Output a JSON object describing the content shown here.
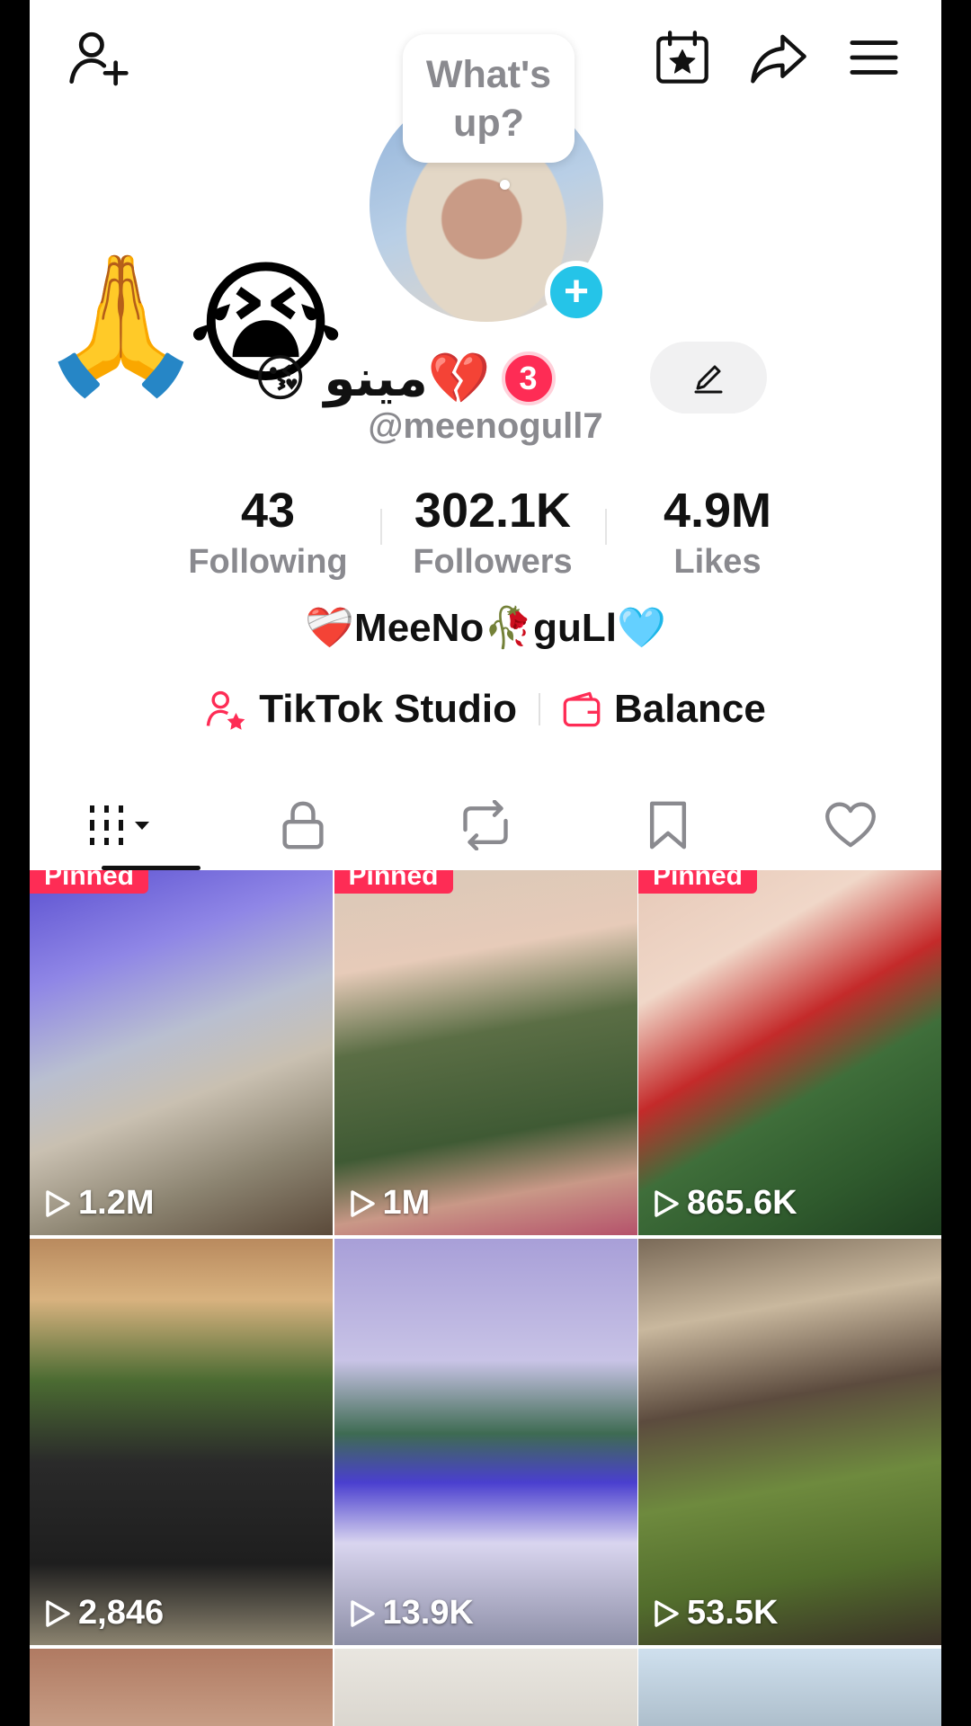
{
  "bubble": {
    "text": "What's up?"
  },
  "profile": {
    "name": "😘 مینو💔",
    "notification_count": "3",
    "handle": "@meenogull7",
    "bio": "❤️‍🩹MeeNo🥀guLl🩵",
    "emojis": [
      "🙏",
      "😭"
    ]
  },
  "stats": [
    {
      "value": "43",
      "label": "Following"
    },
    {
      "value": "302.1K",
      "label": "Followers"
    },
    {
      "value": "4.9M",
      "label": "Likes"
    }
  ],
  "tools": {
    "studio": "TikTok Studio",
    "balance": "Balance"
  },
  "videos": [
    {
      "views": "1.2M",
      "pinned": "Pinned"
    },
    {
      "views": "1M",
      "pinned": "Pinned"
    },
    {
      "views": "865.6K",
      "pinned": "Pinned"
    },
    {
      "views": "2,846"
    },
    {
      "views": "13.9K"
    },
    {
      "views": "53.5K"
    }
  ],
  "icons": {
    "add_friend": "add-person-icon",
    "calendar": "calendar-star-icon",
    "share": "share-arrow-icon",
    "menu": "hamburger-menu-icon"
  },
  "colors": {
    "accent": "#fe2c55",
    "avatar_plus": "#25c4e8"
  }
}
